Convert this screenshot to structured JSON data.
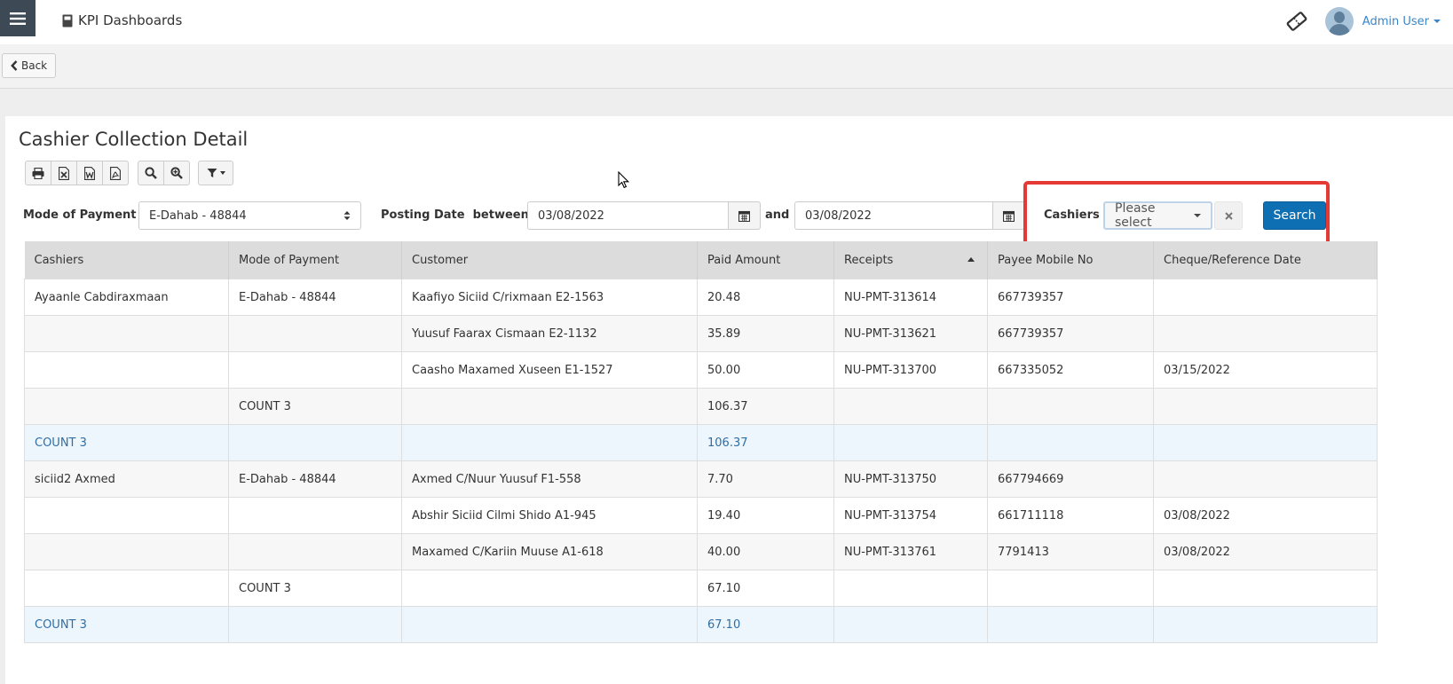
{
  "header": {
    "app_title": "KPI Dashboards",
    "user_name": "Admin User",
    "icons": [
      "menu-icon",
      "book-icon",
      "ticket-icon",
      "avatar",
      "caret-down-icon"
    ]
  },
  "subbar": {
    "back_label": "Back"
  },
  "page": {
    "title": "Cashier Collection Detail"
  },
  "toolbar": {
    "icons": [
      "print-icon",
      "excel-icon",
      "word-icon",
      "pdf-icon",
      "search-icon",
      "zoom-icon",
      "filter-icon"
    ]
  },
  "filters": {
    "mode_label": "Mode of Payment",
    "mode_value": "E-Dahab - 48844",
    "posting_label": "Posting Date",
    "between_label": "between",
    "date_from": "03/08/2022",
    "and_label": "and",
    "date_to": "03/08/2022",
    "cashiers_label": "Cashiers",
    "cashiers_placeholder": "Please select",
    "search_label": "Search"
  },
  "table": {
    "columns": [
      "Cashiers",
      "Mode of Payment",
      "Customer",
      "Paid Amount",
      "Receipts",
      "Payee Mobile No",
      "Cheque/Reference Date"
    ],
    "sorted_column": "Receipts",
    "rows": [
      {
        "type": "data",
        "cells": [
          "Ayaanle Cabdiraxmaan",
          "E-Dahab - 48844",
          "Kaafiyo Siciid C/rixmaan E2-1563",
          "20.48",
          "NU-PMT-313614",
          "667739357",
          ""
        ]
      },
      {
        "type": "data",
        "cells": [
          "",
          "",
          "Yuusuf Faarax Cismaan E2-1132",
          "35.89",
          "NU-PMT-313621",
          "667739357",
          ""
        ]
      },
      {
        "type": "data",
        "cells": [
          "",
          "",
          "Caasho Maxamed Xuseen E1-1527",
          "50.00",
          "NU-PMT-313700",
          "667335052",
          "03/15/2022"
        ]
      },
      {
        "type": "subtotal",
        "cells": [
          "",
          "COUNT 3",
          "",
          "106.37",
          "",
          "",
          ""
        ]
      },
      {
        "type": "group",
        "cells": [
          "COUNT 3",
          "",
          "",
          "106.37",
          "",
          "",
          ""
        ]
      },
      {
        "type": "data",
        "cells": [
          "siciid2 Axmed",
          "E-Dahab - 48844",
          "Axmed C/Nuur Yuusuf F1-558",
          "7.70",
          "NU-PMT-313750",
          "667794669",
          ""
        ]
      },
      {
        "type": "data",
        "cells": [
          "",
          "",
          "Abshir Siciid Cilmi Shido A1-945",
          "19.40",
          "NU-PMT-313754",
          "661711118",
          "03/08/2022"
        ]
      },
      {
        "type": "data",
        "cells": [
          "",
          "",
          "Maxamed C/Kariin Muuse A1-618",
          "40.00",
          "NU-PMT-313761",
          "7791413",
          "03/08/2022"
        ]
      },
      {
        "type": "subtotal",
        "cells": [
          "",
          "COUNT 3",
          "",
          "67.10",
          "",
          "",
          ""
        ]
      },
      {
        "type": "group",
        "cells": [
          "COUNT 3",
          "",
          "",
          "67.10",
          "",
          "",
          ""
        ]
      }
    ]
  },
  "colors": {
    "accent": "#0f6fb3",
    "highlight": "#e53935",
    "group_text": "#2f6ea5",
    "header_bg": "#dcdcdc"
  }
}
